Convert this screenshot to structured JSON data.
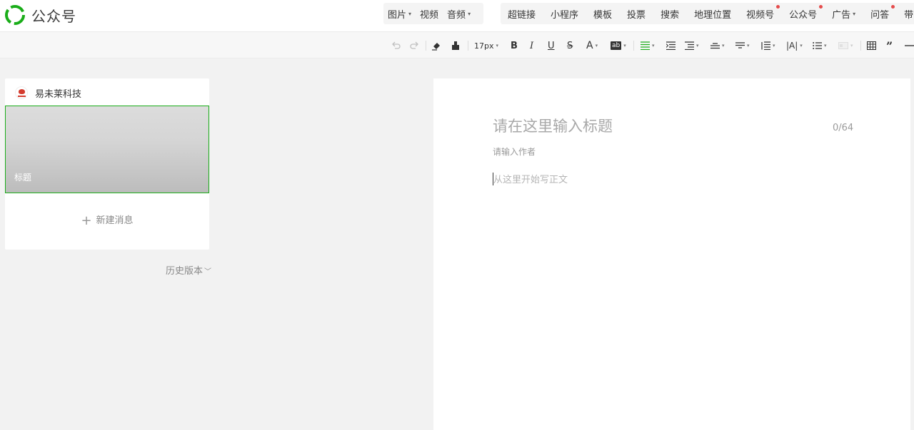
{
  "app": {
    "title": "公众号",
    "brand_color": "#1aad19"
  },
  "header": {
    "media": [
      {
        "label": "图片",
        "dropdown": true
      },
      {
        "label": "视频",
        "dropdown": false
      },
      {
        "label": "音频",
        "dropdown": true
      }
    ],
    "insert": [
      {
        "label": "超链接",
        "dropdown": false,
        "dot": false
      },
      {
        "label": "小程序",
        "dropdown": false,
        "dot": false
      },
      {
        "label": "模板",
        "dropdown": false,
        "dot": false
      },
      {
        "label": "投票",
        "dropdown": false,
        "dot": false
      },
      {
        "label": "搜索",
        "dropdown": false,
        "dot": false
      },
      {
        "label": "地理位置",
        "dropdown": false,
        "dot": false
      },
      {
        "label": "视频号",
        "dropdown": false,
        "dot": true
      },
      {
        "label": "公众号",
        "dropdown": false,
        "dot": true
      },
      {
        "label": "广告",
        "dropdown": true,
        "dot": false
      },
      {
        "label": "问答",
        "dropdown": false,
        "dot": true
      },
      {
        "label": "带货",
        "dropdown": false,
        "dot": false
      }
    ]
  },
  "toolbar": {
    "font_size": "17px",
    "bold": "B",
    "italic": "I",
    "underline": "U",
    "strike": "S",
    "font_color": "A",
    "bg_color": "ab",
    "letter_spacing": "|A|"
  },
  "sidebar": {
    "account_name": "易未莱科技",
    "article_title": "标题",
    "new_message": "新建消息",
    "history": "历史版本"
  },
  "editor": {
    "title_placeholder": "请在这里输入标题",
    "title_count": "0/64",
    "author_placeholder": "请输入作者",
    "body_placeholder": "从这里开始写正文"
  }
}
